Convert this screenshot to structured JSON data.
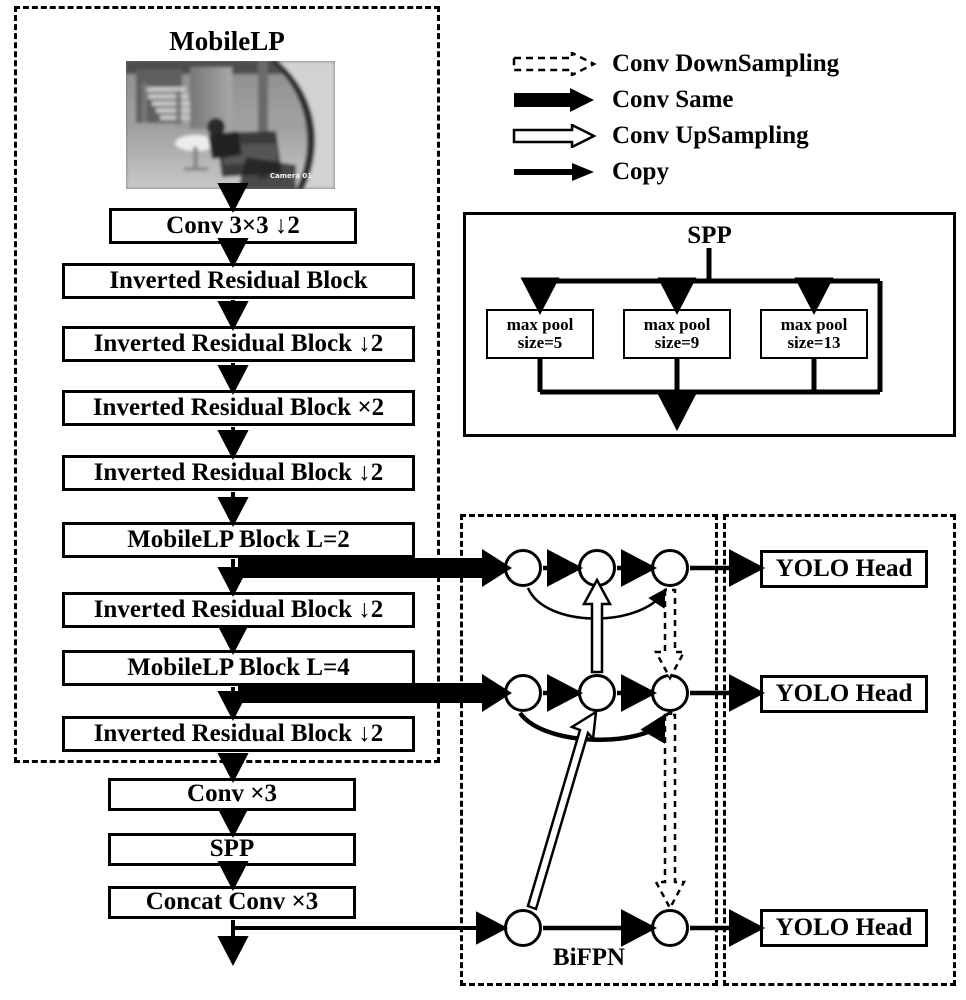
{
  "figure": {
    "type": "network-architecture-diagram",
    "background": "#ffffff",
    "line_color": "#000000"
  },
  "backbone": {
    "title": "MobileLP",
    "input_image": {
      "name": "surveillance-frame",
      "description": "grayscale indoor surveillance frame: staircase, round table, sofa",
      "overlay_text": "Camera 01"
    },
    "blocks": [
      {
        "label": "Conv 3×3   ↓2"
      },
      {
        "label": "Inverted Residual Block"
      },
      {
        "label": "Inverted Residual Block ↓2"
      },
      {
        "label": "Inverted Residual Block ×2"
      },
      {
        "label": "Inverted Residual Block ↓2"
      },
      {
        "label": "MobileLP Block    L=2"
      },
      {
        "label": "Inverted Residual Block ↓2"
      },
      {
        "label": "MobileLP Block    L=4"
      },
      {
        "label": "Inverted Residual Block ↓2"
      }
    ],
    "neck_blocks": [
      {
        "label": "Conv ×3"
      },
      {
        "label": "SPP"
      },
      {
        "label": "Concat Conv ×3"
      }
    ]
  },
  "legend": {
    "items": [
      {
        "label": "Conv DownSampling",
        "style": "dashed-hollow-arrow"
      },
      {
        "label": "Conv Same",
        "style": "thick-filled-arrow"
      },
      {
        "label": "Conv UpSampling",
        "style": "solid-hollow-arrow"
      },
      {
        "label": "Copy",
        "style": "thin-filled-arrow"
      }
    ]
  },
  "spp_panel": {
    "title": "SPP",
    "pools": [
      {
        "line1": "max pool",
        "line2": "size=5"
      },
      {
        "line1": "max pool",
        "line2": "size=9"
      },
      {
        "line1": "max pool",
        "line2": "size=13"
      }
    ],
    "has_bypass": true
  },
  "bifpn": {
    "title": "BiFPN",
    "levels": [
      {
        "name": "P-high",
        "node_count": 3
      },
      {
        "name": "P-mid",
        "node_count": 3
      },
      {
        "name": "P-low",
        "node_count": 2
      }
    ]
  },
  "heads": {
    "items": [
      {
        "label": "YOLO Head"
      },
      {
        "label": "YOLO Head"
      },
      {
        "label": "YOLO Head"
      }
    ]
  }
}
